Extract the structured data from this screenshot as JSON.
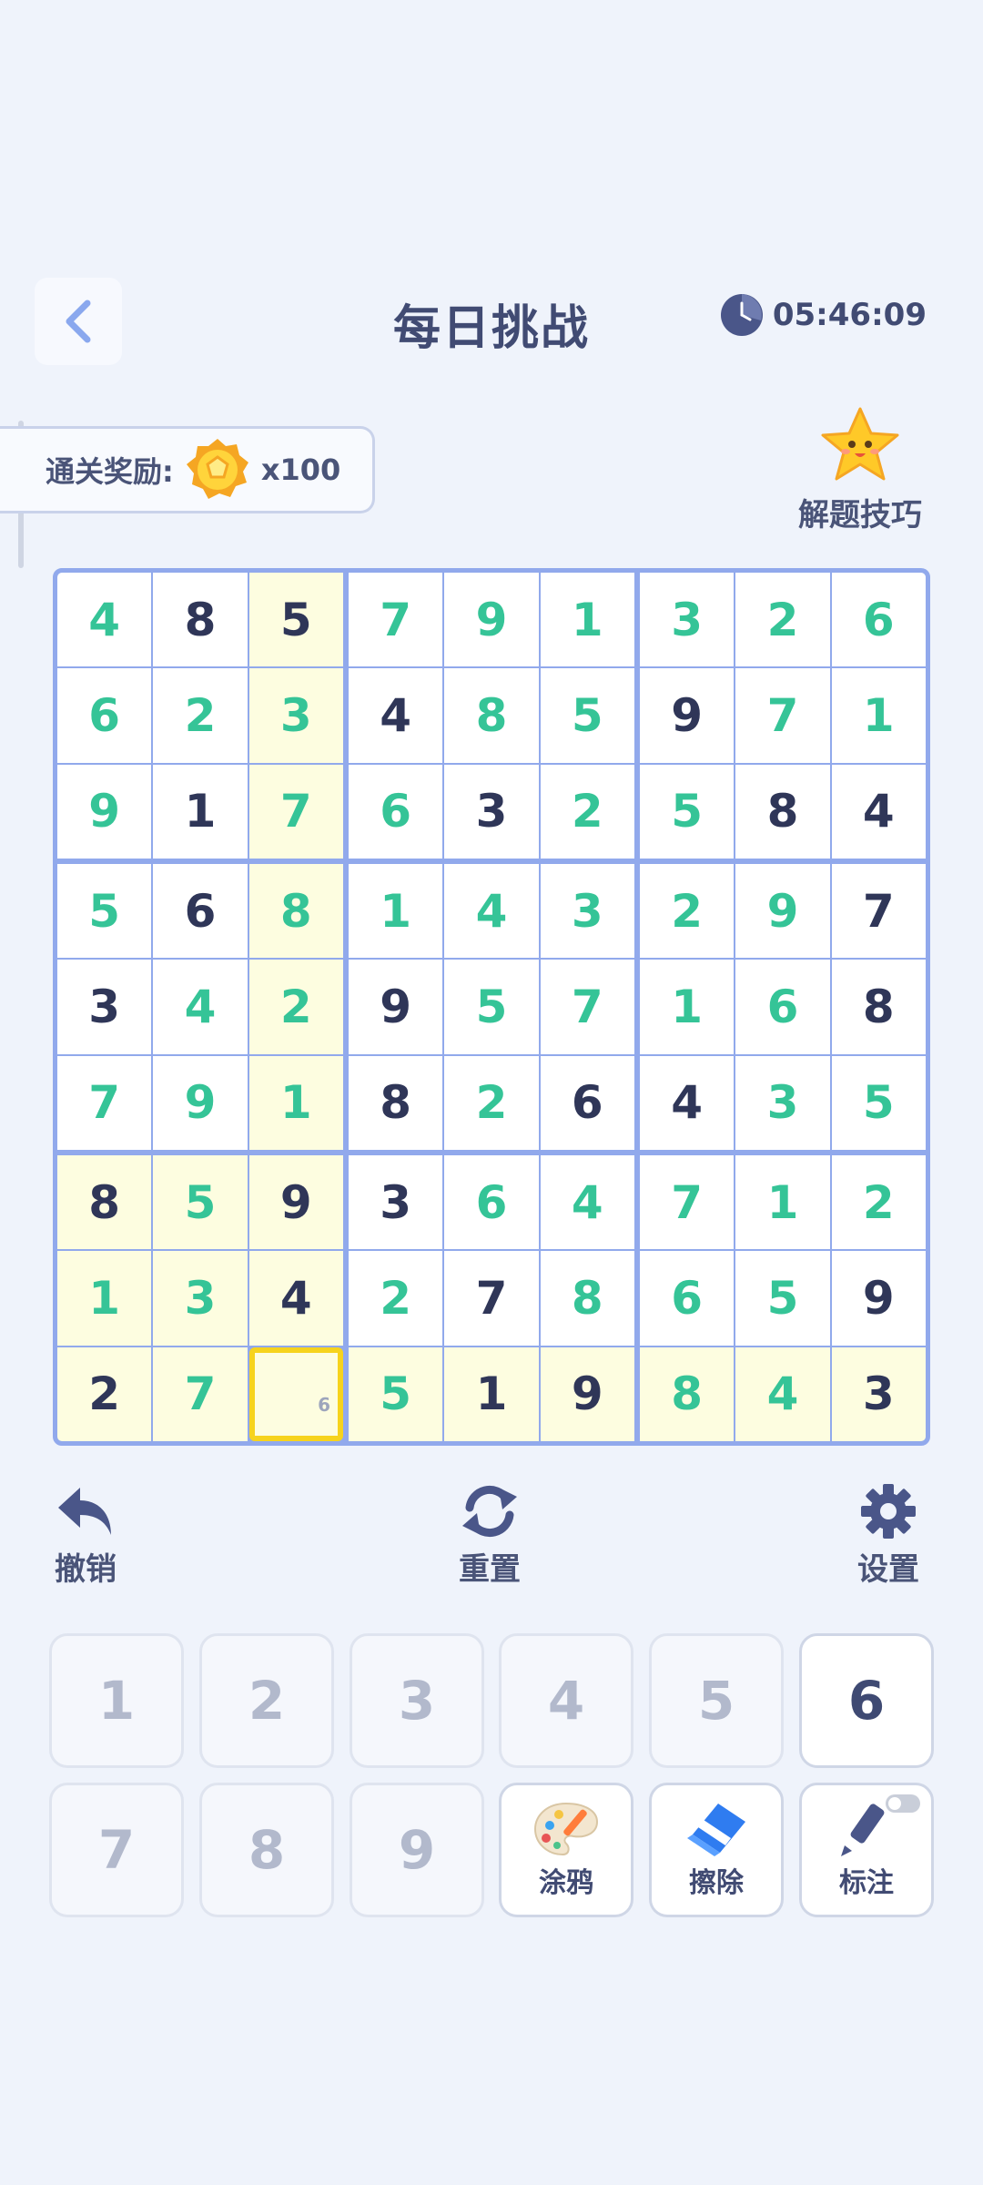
{
  "header": {
    "title": "每日挑战",
    "timer": "05:46:09"
  },
  "reward": {
    "label": "通关奖励:",
    "amount": "x100"
  },
  "tips": {
    "label": "解题技巧"
  },
  "board": {
    "grid": [
      [
        4,
        8,
        5,
        7,
        9,
        1,
        3,
        2,
        6
      ],
      [
        6,
        2,
        3,
        4,
        8,
        5,
        9,
        7,
        1
      ],
      [
        9,
        1,
        7,
        6,
        3,
        2,
        5,
        8,
        4
      ],
      [
        5,
        6,
        8,
        1,
        4,
        3,
        2,
        9,
        7
      ],
      [
        3,
        4,
        2,
        9,
        5,
        7,
        1,
        6,
        8
      ],
      [
        7,
        9,
        1,
        8,
        2,
        6,
        4,
        3,
        5
      ],
      [
        8,
        5,
        9,
        3,
        6,
        4,
        7,
        1,
        2
      ],
      [
        1,
        3,
        4,
        2,
        7,
        8,
        6,
        5,
        9
      ],
      [
        2,
        7,
        0,
        5,
        1,
        9,
        8,
        4,
        3
      ]
    ],
    "given": [
      [
        0,
        1,
        1,
        0,
        0,
        0,
        0,
        0,
        0
      ],
      [
        0,
        0,
        0,
        1,
        0,
        0,
        1,
        0,
        0
      ],
      [
        0,
        1,
        0,
        0,
        1,
        0,
        0,
        1,
        1
      ],
      [
        0,
        1,
        0,
        0,
        0,
        0,
        0,
        0,
        1
      ],
      [
        1,
        0,
        0,
        1,
        0,
        0,
        0,
        0,
        1
      ],
      [
        0,
        0,
        0,
        1,
        0,
        1,
        1,
        0,
        0
      ],
      [
        1,
        0,
        1,
        1,
        0,
        0,
        0,
        0,
        0
      ],
      [
        0,
        0,
        1,
        0,
        1,
        0,
        0,
        0,
        1
      ],
      [
        1,
        0,
        0,
        0,
        1,
        1,
        0,
        0,
        1
      ]
    ],
    "selected": {
      "row": 8,
      "col": 2
    },
    "note": "6",
    "colors": {
      "given": "#2f3658",
      "filled": "#35c497",
      "highlight": "#fdfde0",
      "border": "#91a9ec",
      "selected": "#f6d31d"
    }
  },
  "tools": {
    "undo": "撤销",
    "reset": "重置",
    "settings": "设置"
  },
  "keypad": {
    "numbers": [
      "1",
      "2",
      "3",
      "4",
      "5",
      "6",
      "7",
      "8",
      "9"
    ],
    "active": "6",
    "doodle": "涂鸦",
    "erase": "擦除",
    "mark": "标注"
  }
}
